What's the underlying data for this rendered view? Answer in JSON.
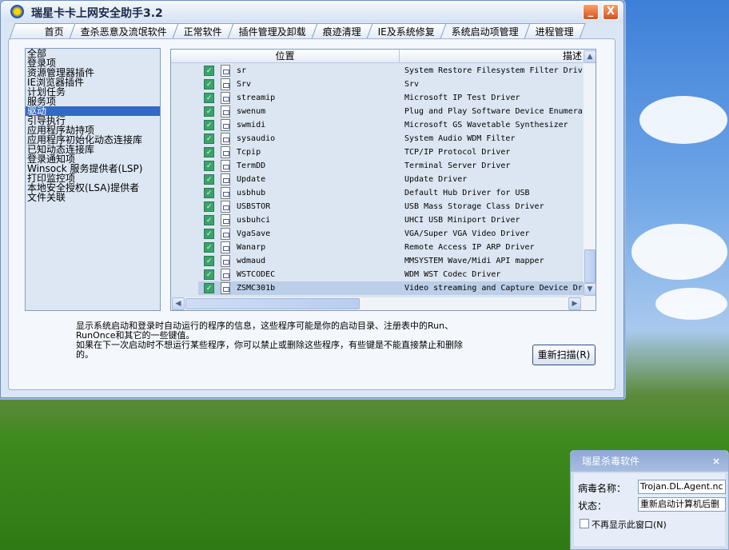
{
  "window": {
    "title": "瑞星卡卡上网安全助手3.2",
    "minimize_label": "_",
    "close_label": "X"
  },
  "tabs": [
    "首页",
    "查杀恶意及流氓软件",
    "正常软件",
    "插件管理及卸载",
    "痕迹清理",
    "IE及系统修复",
    "系统启动项管理",
    "进程管理"
  ],
  "active_tab": 6,
  "categories": [
    "全部",
    "登录项",
    "资源管理器插件",
    "IE浏览器插件",
    "计划任务",
    "服务项",
    "驱动",
    "引导执行",
    "应用程序劫持项",
    "应用程序初始化动态连接库",
    "已知动态连接库",
    "登录通知项",
    "Winsock 服务提供者(LSP)",
    "打印监控项",
    "本地安全授权(LSA)提供者",
    "文件关联"
  ],
  "selected_category": 6,
  "table": {
    "columns": [
      "位置",
      "描述"
    ],
    "rows": [
      {
        "name": "sr",
        "desc": "System Restore Filesystem Filter Driv"
      },
      {
        "name": "Srv",
        "desc": "Srv"
      },
      {
        "name": "streamip",
        "desc": "Microsoft IP Test Driver"
      },
      {
        "name": "swenum",
        "desc": "Plug and Play Software Device Enumera"
      },
      {
        "name": "swmidi",
        "desc": "Microsoft GS Wavetable Synthesizer"
      },
      {
        "name": "sysaudio",
        "desc": "System Audio WDM Filter"
      },
      {
        "name": "Tcpip",
        "desc": "TCP/IP Protocol Driver"
      },
      {
        "name": "TermDD",
        "desc": "Terminal Server Driver"
      },
      {
        "name": "Update",
        "desc": "Update Driver"
      },
      {
        "name": "usbhub",
        "desc": "Default Hub Driver for USB"
      },
      {
        "name": "USBSTOR",
        "desc": "USB Mass Storage Class Driver"
      },
      {
        "name": "usbuhci",
        "desc": "UHCI USB Miniport Driver"
      },
      {
        "name": "VgaSave",
        "desc": "VGA/Super VGA Video Driver"
      },
      {
        "name": "Wanarp",
        "desc": "Remote Access IP ARP Driver"
      },
      {
        "name": "wdmaud",
        "desc": "MMSYSTEM Wave/Midi API mapper"
      },
      {
        "name": "WSTCODEC",
        "desc": "WDM WST Codec Driver"
      },
      {
        "name": "ZSMC301b",
        "desc": "Video streaming and Capture Device Dr"
      }
    ],
    "selected_row": 16
  },
  "description": [
    "显示系统启动和登录时自动运行的程序的信息，这些程序可能是你的启动目录、注册表中的Run、",
    "RunOnce和其它的一些键值。",
    "如果在下一次启动时不想运行某些程序，你可以禁止或删除这些程序，有些键是不能直接禁止和删除",
    "的。"
  ],
  "rescan_button": "重新扫描(R)",
  "popup": {
    "title": "瑞星杀毒软件",
    "close": "×",
    "virus_label": "病毒名称：",
    "virus_value": "Trojan.DL.Agent.nc",
    "status_label": "状态：",
    "status_value": "重新启动计算机后删",
    "dont_show": "不再显示此窗口(N)"
  }
}
